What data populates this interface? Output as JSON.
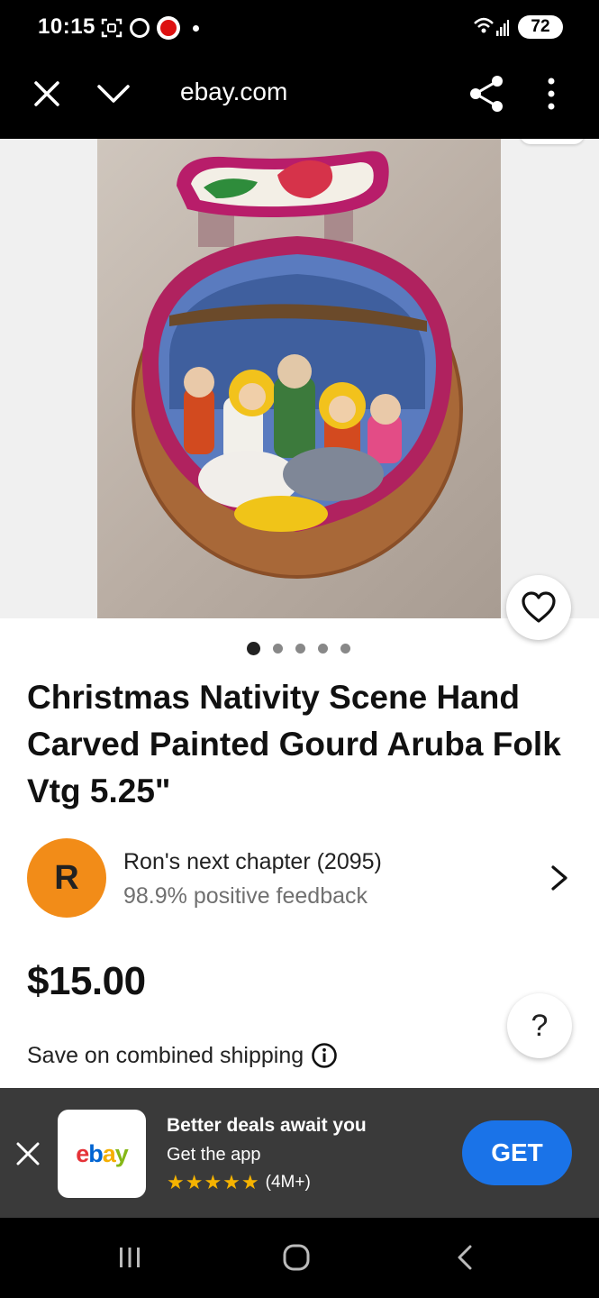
{
  "status_bar": {
    "time": "10:15",
    "battery": "72",
    "icons": [
      "scan-icon",
      "circle-icon",
      "app-icon",
      "dot-icon",
      "wifi-icon",
      "signal-icon",
      "battery-icon"
    ]
  },
  "browser": {
    "url": "ebay.com",
    "icons": [
      "close-icon",
      "chevron-down-icon",
      "share-icon",
      "more-vert-icon"
    ]
  },
  "product": {
    "image_count": 5,
    "active_image": 1,
    "title": "Christmas Nativity Scene Hand Carved Painted Gourd Aruba Folk Vtg 5.25\"",
    "seller": {
      "initial": "R",
      "name": "Ron's next chapter (2095)",
      "feedback": "98.9% positive feedback",
      "avatar_color": "#f28c18"
    },
    "price": "$15.00",
    "shipping": "Save on combined shipping",
    "help_label": "?"
  },
  "app_banner": {
    "logo": "ebay",
    "title": "Better deals await you",
    "subtitle": "Get the app",
    "stars": "★★★★★",
    "rating_count": "(4M+)",
    "cta": "GET",
    "cta_color": "#1a73e8"
  },
  "colors": {
    "ebay_red": "#e53238",
    "ebay_blue": "#0064d2",
    "ebay_yellow": "#f5af02",
    "ebay_green": "#86b817"
  }
}
